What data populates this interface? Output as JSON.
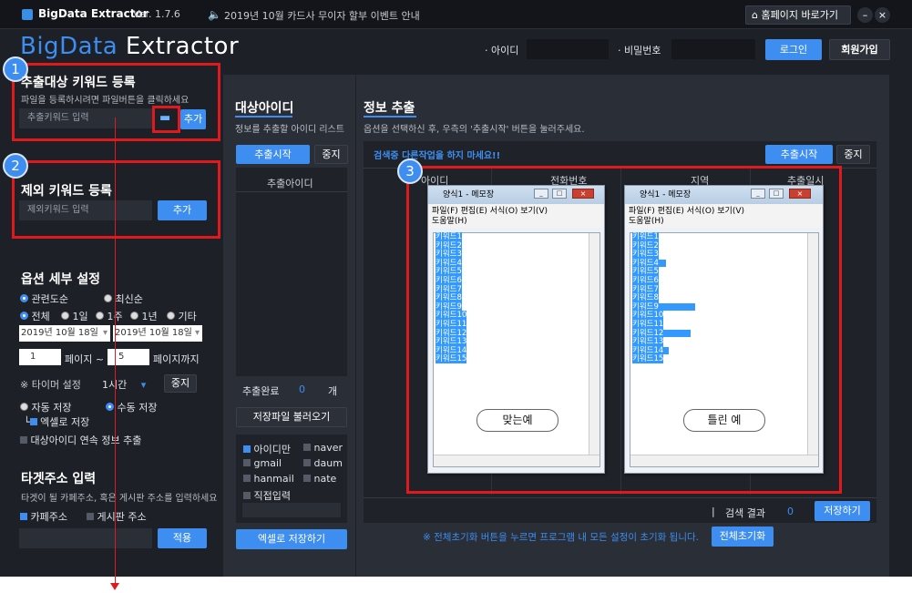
{
  "titlebar": {
    "brand": "BigData Extractor",
    "version": "Ver. 1.7.6",
    "notice": "2019년 10월 카드사 무이자 할부 이벤트 안내",
    "home_button": "홈페이지 바로가기",
    "minimize": "–",
    "close": "×"
  },
  "header": {
    "logo_part1": "BigData",
    "logo_part2": " Extractor",
    "id_label": "· 아이디",
    "pw_label": "· 비밀번호",
    "login": "로그인",
    "signup": "회원가입"
  },
  "left": {
    "badge1": "1",
    "badge2": "2",
    "extract_title": "추출대상 키워드 등록",
    "extract_sub": "파일을 등록하시려면 파일버튼을 클릭하세요",
    "extract_placeholder": "추출키워드 입력",
    "extract_add": "추가",
    "exclude_title": "제외 키워드 등록",
    "exclude_placeholder": "제외키워드 입력",
    "exclude_add": "추가",
    "options_title": "옵션 세부 설정",
    "sort_relevance": "관련도순",
    "sort_latest": "최신순",
    "period_all": "전체",
    "period_1d": "1일",
    "period_1w": "1주",
    "period_1y": "1년",
    "period_etc": "기타",
    "date_from": "2019년 10월 18일",
    "date_to": "2019년 10월 18일",
    "page_from": "1",
    "page_label": "페이지 ~",
    "page_to": "5",
    "page_to_label": "페이지까지",
    "timer_label": "※ 타이머 설정",
    "timer_value": "1시간",
    "timer_stop": "중지",
    "auto_save": "자동 저장",
    "manual_save": "수동 저장",
    "excel_save": "엑셀로 저장",
    "continuous": "대상아이디 연속 정보 추출",
    "target_title": "타겟주소 입력",
    "target_sub": "타겟이 될 카페주소, 혹은 게시판 주소를 입력하세요",
    "cafe_addr": "카페주소",
    "board_addr": "게시판 주소",
    "apply": "적용"
  },
  "middle": {
    "title": "대상아이디",
    "sub": "정보를 추출할 아이디 리스트",
    "start": "추출시작",
    "stop": "중지",
    "col_header": "추출아이디",
    "done_label": "추출완료",
    "done_count": "0",
    "done_unit": "개",
    "load_file": "저장파일 불러오기",
    "id_only": "아이디만",
    "naver": "naver",
    "gmail": "gmail",
    "daum": "daum",
    "hanmail": "hanmail",
    "nate": "nate",
    "direct": "직접입력",
    "save_excel": "엑셀로 저장하기"
  },
  "right": {
    "title": "정보 추출",
    "sub": "옵션을 선택하신 후, 우측의 '추출시작' 버튼을 눌러주세요.",
    "warning": "검색중 다른작업을 하지 마세요!!",
    "start": "추출시작",
    "stop": "중지",
    "columns": [
      "아이디",
      "전화번호",
      "지역",
      "추출일시"
    ],
    "badge3": "3",
    "result_label": "검색 결과",
    "result_count": "0",
    "save": "저장하기",
    "reset_notice": "※ 전체초기화 버튼을 누르면 프로그램 내 모든 설정이 초기화 됩니다.",
    "reset": "전체초기화"
  },
  "notepad_left": {
    "title": "양식1 - 메모장",
    "menu1": "파일(F)   편집(E)   서식(O)   보기(V)",
    "menu2": "도움말(H)",
    "lines": [
      "키워드1",
      "키워드2",
      "키워드3",
      "키워드4",
      "키워드5",
      "키워드6",
      "키워드7",
      "키워드8",
      "키워드9",
      "키워드10",
      "키워드11",
      "키워드12",
      "키워드13",
      "키워드14",
      "키워드15"
    ],
    "label": "맞는예"
  },
  "notepad_right": {
    "title": "양식1 - 메모장",
    "menu1": "파일(F)   편집(E)   서식(O)   보기(V)",
    "menu2": "도움말(H)",
    "lines": [
      "키워드1",
      "키워드2",
      "키워드3",
      "키워드4",
      "키워드5",
      "키워드6",
      "키워드7",
      "키워드8",
      "키워드9",
      "키워드10",
      "키워드11",
      "키워드12",
      "키워드13",
      "키워드14",
      "키워드15"
    ],
    "label": "틀린 예"
  },
  "colors": {
    "accent": "#3d8ef0",
    "highlight": "#e0191d",
    "background": "#1d2027"
  }
}
